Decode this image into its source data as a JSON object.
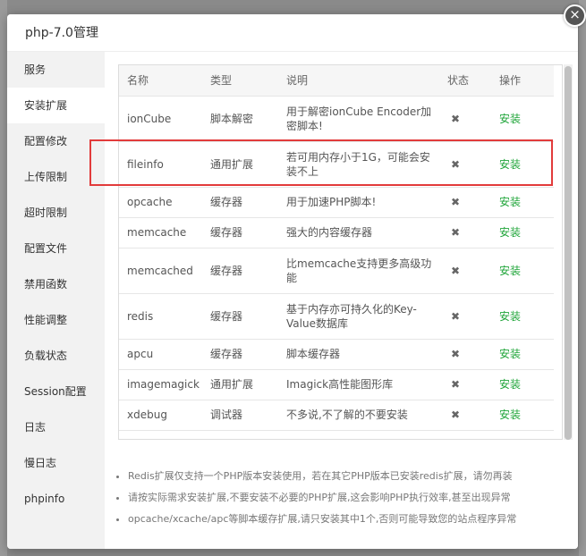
{
  "dialog": {
    "title": "php-7.0管理",
    "close_label": "×"
  },
  "sidebar": {
    "items": [
      {
        "label": "服务"
      },
      {
        "label": "安装扩展"
      },
      {
        "label": "配置修改"
      },
      {
        "label": "上传限制"
      },
      {
        "label": "超时限制"
      },
      {
        "label": "配置文件"
      },
      {
        "label": "禁用函数"
      },
      {
        "label": "性能调整"
      },
      {
        "label": "负载状态"
      },
      {
        "label": "Session配置"
      },
      {
        "label": "日志"
      },
      {
        "label": "慢日志"
      },
      {
        "label": "phpinfo"
      }
    ]
  },
  "table": {
    "headers": {
      "name": "名称",
      "type": "类型",
      "desc": "说明",
      "status": "状态",
      "action": "操作"
    },
    "rows": [
      {
        "name": "ionCube",
        "type": "脚本解密",
        "desc": "用于解密ionCube Encoder加密脚本!",
        "status": "✖",
        "action": "安装"
      },
      {
        "name": "fileinfo",
        "type": "通用扩展",
        "desc": "若可用内存小于1G，可能会安装不上",
        "status": "✖",
        "action": "安装"
      },
      {
        "name": "opcache",
        "type": "缓存器",
        "desc": "用于加速PHP脚本!",
        "status": "✖",
        "action": "安装"
      },
      {
        "name": "memcache",
        "type": "缓存器",
        "desc": "强大的内容缓存器",
        "status": "✖",
        "action": "安装"
      },
      {
        "name": "memcached",
        "type": "缓存器",
        "desc": "比memcache支持更多高级功能",
        "status": "✖",
        "action": "安装"
      },
      {
        "name": "redis",
        "type": "缓存器",
        "desc": "基于内存亦可持久化的Key-Value数据库",
        "status": "✖",
        "action": "安装"
      },
      {
        "name": "apcu",
        "type": "缓存器",
        "desc": "脚本缓存器",
        "status": "✖",
        "action": "安装"
      },
      {
        "name": "imagemagick",
        "type": "通用扩展",
        "desc": "Imagick高性能图形库",
        "status": "✖",
        "action": "安装"
      },
      {
        "name": "xdebug",
        "type": "调试器",
        "desc": "不多说,不了解的不要安装",
        "status": "✖",
        "action": "安装"
      }
    ]
  },
  "notes": [
    "Redis扩展仅支持一个PHP版本安装使用，若在其它PHP版本已安装redis扩展，请勿再装",
    "请按实际需求安装扩展,不要安装不必要的PHP扩展,这会影响PHP执行效率,甚至出现异常",
    "opcache/xcache/apc等脚本缓存扩展,请只安装其中1个,否则可能导致您的站点程序异常"
  ],
  "colors": {
    "install_link": "#20a53a",
    "highlight_border": "#e23b3b",
    "sidebar_bg": "#f2f2f2"
  }
}
